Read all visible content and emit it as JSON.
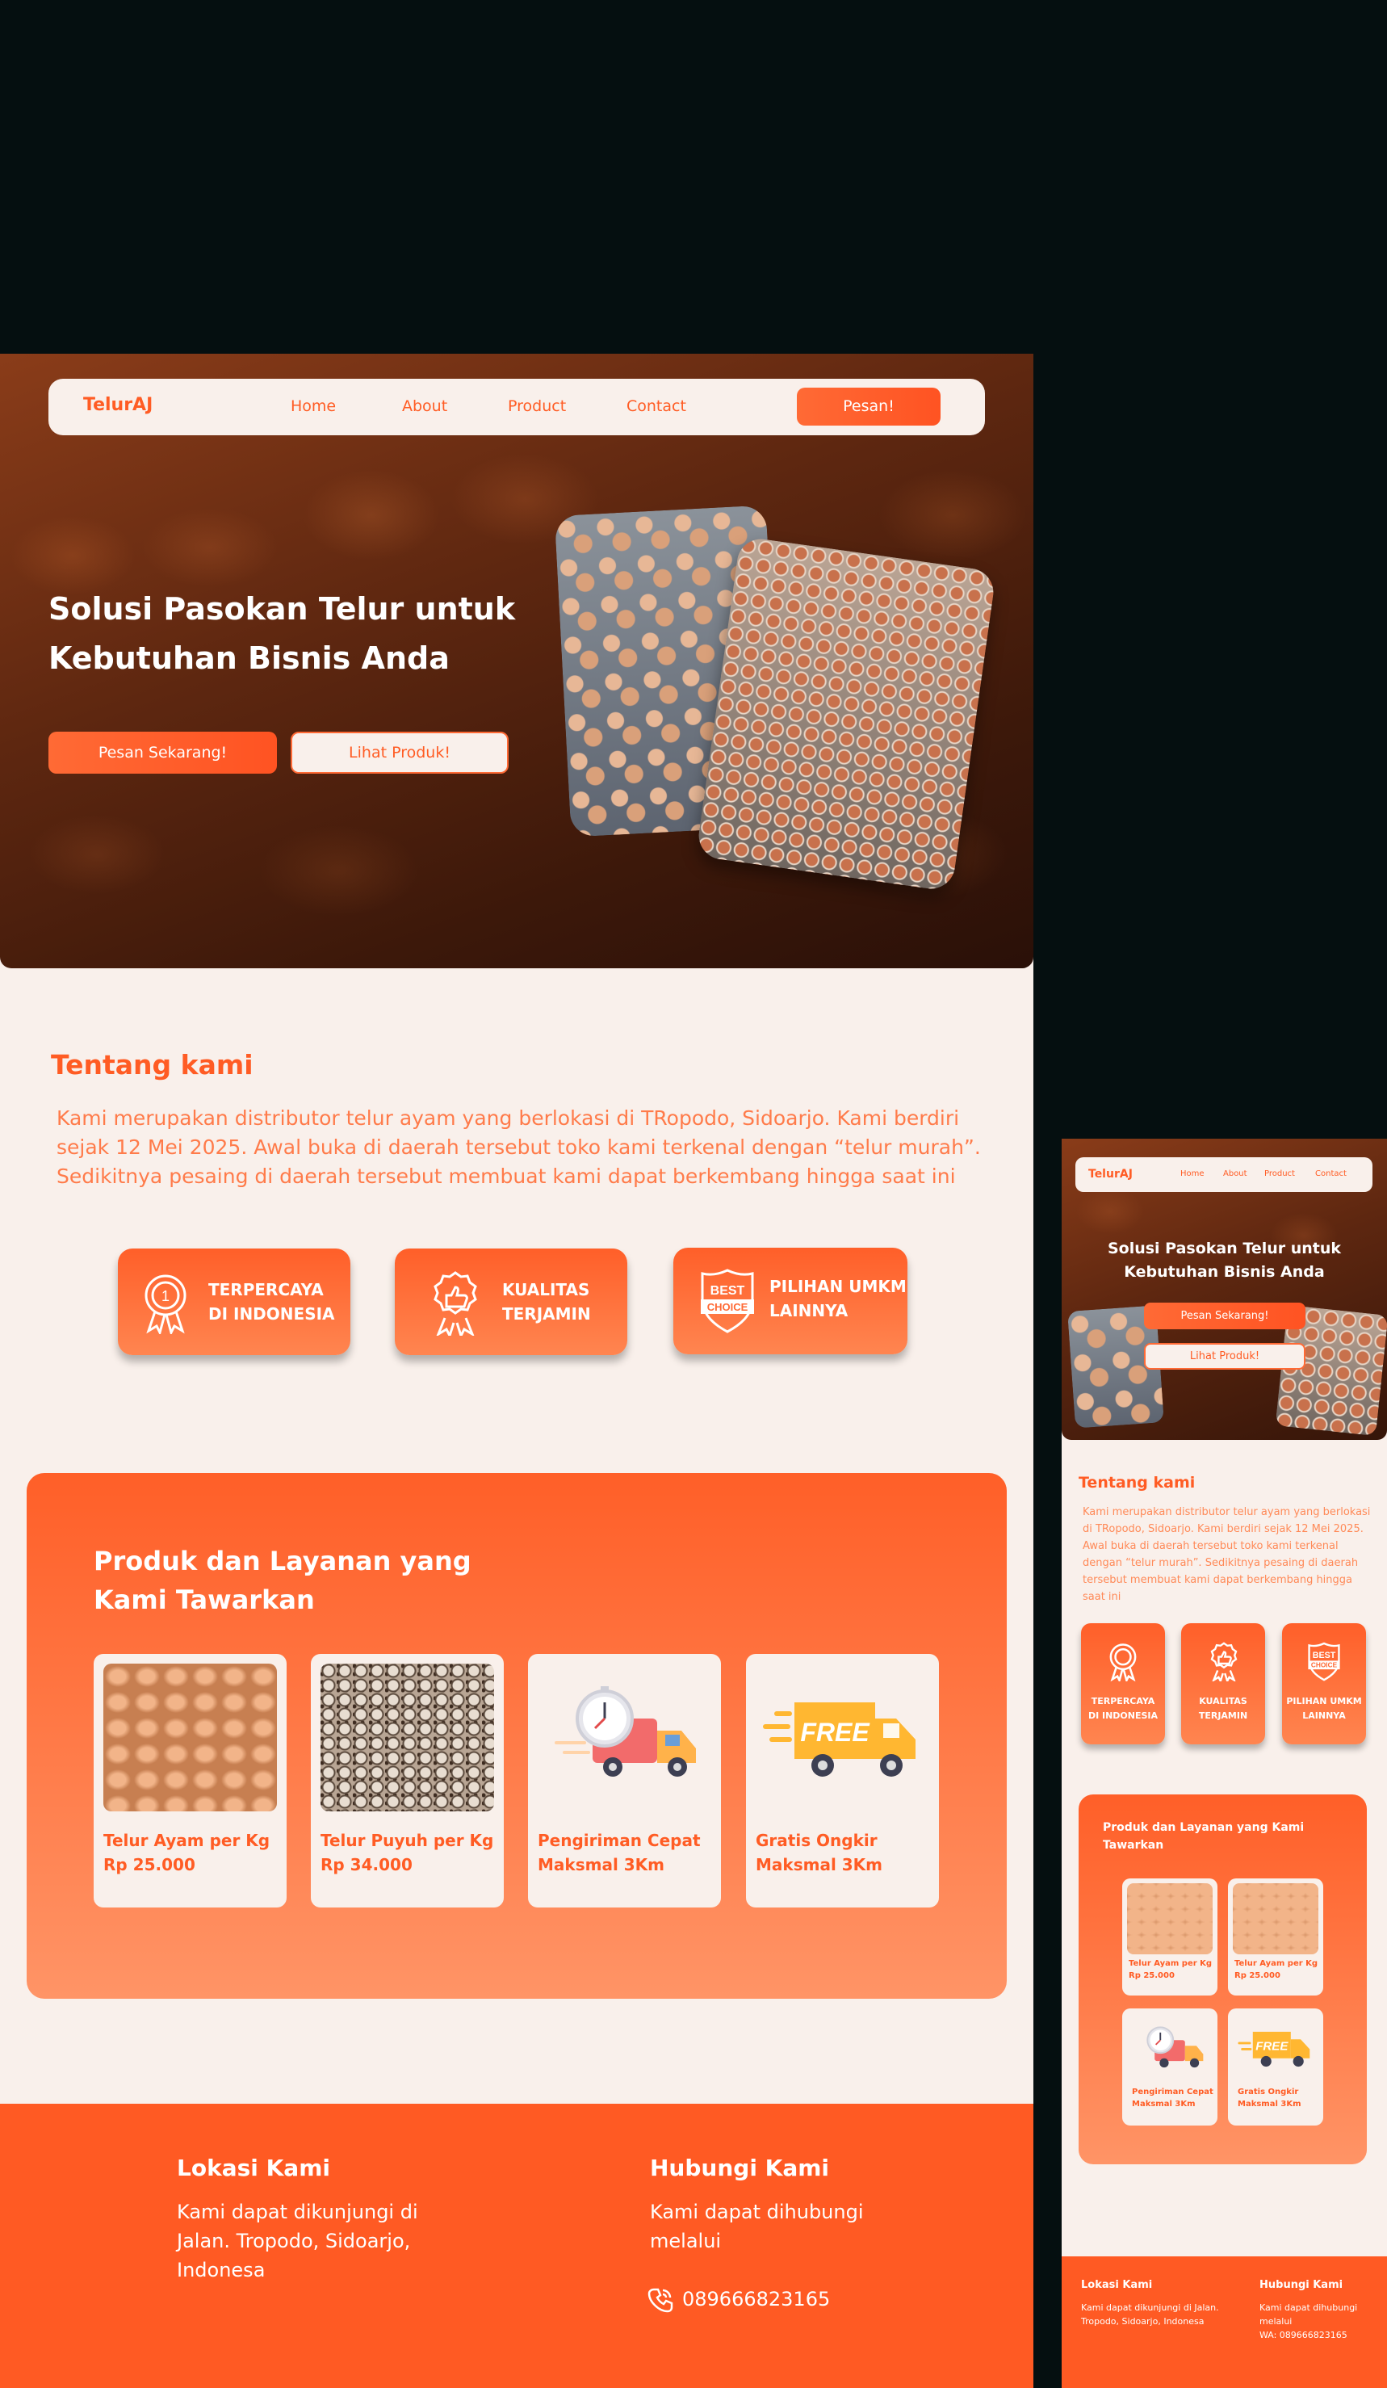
{
  "brand": "TelurAJ",
  "nav": {
    "home": "Home",
    "about": "About",
    "product": "Product",
    "contact": "Contact",
    "order_button": "Pesan!"
  },
  "hero": {
    "title_line1": "Solusi Pasokan Telur untuk",
    "title_line2": "Kebutuhan Bisnis Anda",
    "primary_button": "Pesan Sekarang!",
    "secondary_button": "Lihat Produk!"
  },
  "about": {
    "title": "Tentang kami",
    "text": "Kami merupakan distributor telur ayam yang berlokasi di TRopodo, Sidoarjo. Kami berdiri sejak 12 Mei 2025. Awal buka di daerah tersebut  toko kami terkenal dengan “telur murah”. Sedikitnya pesaing di daerah tersebut membuat kami dapat berkembang hingga saat ini"
  },
  "badges": [
    {
      "line1": "TERPERCAYA",
      "line2": "DI INDONESIA",
      "icon": "medal-icon"
    },
    {
      "line1": "KUALITAS",
      "line2": "TERJAMIN",
      "icon": "thumbs-up-badge-icon"
    },
    {
      "line1": "PILIHAN UMKM",
      "line2": "LAINNYA",
      "icon": "best-choice-shield-icon",
      "icon_text_1": "BEST",
      "icon_text_2": "CHOICE"
    }
  ],
  "products": {
    "title_line1": "Produk dan Layanan yang",
    "title_line2": "Kami Tawarkan",
    "mobile_title": "Produk dan Layanan yang Kami Tawarkan",
    "items": [
      {
        "line1": "Telur Ayam per Kg",
        "line2": "Rp 25.000",
        "image": "brown-eggs"
      },
      {
        "line1": "Telur Puyuh per Kg",
        "line2": "Rp 34.000",
        "image": "quail-eggs"
      },
      {
        "line1": "Pengiriman Cepat",
        "line2": "Maksmal 3Km",
        "image": "delivery-truck-clock"
      },
      {
        "line1": "Gratis Ongkir",
        "line2": "Maksmal 3Km",
        "image": "free-delivery-truck",
        "image_text": "FREE"
      }
    ],
    "mobile_items": [
      {
        "line1": "Telur Ayam per Kg",
        "line2": "Rp 25.000"
      },
      {
        "line1": "Telur Ayam per Kg",
        "line2": "Rp 25.000"
      },
      {
        "line1": "Pengiriman Cepat",
        "line2": "Maksmal 3Km"
      },
      {
        "line1": "Gratis Ongkir",
        "line2": "Maksmal 3Km"
      }
    ]
  },
  "footer": {
    "location_title": "Lokasi Kami",
    "location_text": "Kami dapat dikunjungi di Jalan. Tropodo, Sidoarjo, Indonesa",
    "contact_title": "Hubungi Kami",
    "contact_text": "Kami dapat dihubungi melalui",
    "phone": "089666823165",
    "mobile_contact_text": "Kami dapat dihubungi melalui",
    "mobile_phone": "WA: 089666823165"
  },
  "colors": {
    "accent": "#ff5c24",
    "cream": "#f9f0eb",
    "dark": "#050f10"
  }
}
